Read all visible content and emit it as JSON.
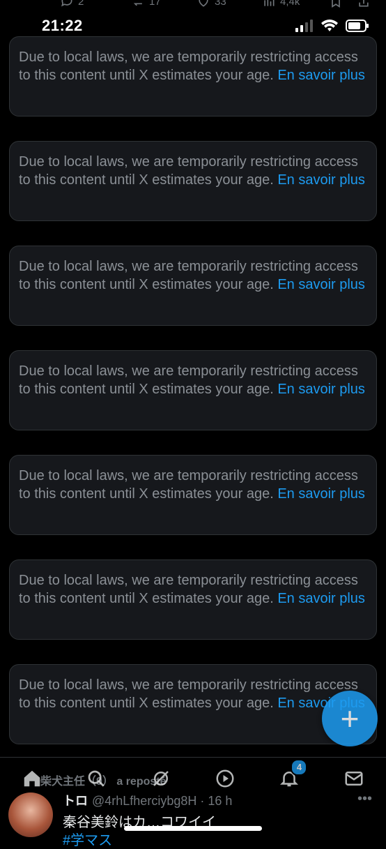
{
  "top_actions": {
    "replies": "2",
    "reposts": "17",
    "likes": "33",
    "views": "4,4k"
  },
  "status_bar": {
    "time": "21:22"
  },
  "notices": [
    {
      "text": "Due to local laws, we are temporarily restricting access to this content until X estimates your age. ",
      "link": "En savoir plus"
    },
    {
      "text": "Due to local laws, we are temporarily restricting access to this content until X estimates your age. ",
      "link": "En savoir plus"
    },
    {
      "text": "Due to local laws, we are temporarily restricting access to this content until X estimates your age. ",
      "link": "En savoir plus"
    },
    {
      "text": "Due to local laws, we are temporarily restricting access to this content until X estimates your age. ",
      "link": "En savoir plus"
    },
    {
      "text": "Due to local laws, we are temporarily restricting access to this content until X estimates your age. ",
      "link": "En savoir plus"
    },
    {
      "text": "Due to local laws, we are temporarily restricting access to this content until X estimates your age. ",
      "link": "En savoir plus"
    },
    {
      "text": "Due to local laws, we are temporarily restricting access to this content until X estimates your age. ",
      "link": "En savoir plus"
    }
  ],
  "fab": {
    "label": "+"
  },
  "next_tweet": {
    "repost_line": "柴犬主任（9） a reposté",
    "name": "トロ",
    "handle_time": "@4rhLfherciybg8H · 16 h",
    "text": "秦谷美鈴はカ…コワイイ",
    "hashtag": "#学マス"
  },
  "bottom_nav": {
    "notifications_badge": "4"
  },
  "colors": {
    "accent": "#1d9bf0",
    "card_bg": "#16181c",
    "card_border": "#2f3336",
    "muted_text": "#8b9096"
  },
  "icons": {
    "reply": "reply-icon",
    "repost": "repost-icon",
    "like": "heart-icon",
    "views": "views-icon",
    "bookmark": "bookmark-icon",
    "share": "share-icon",
    "home": "home-icon",
    "search": "search-icon",
    "grok": "grok-icon",
    "video": "play-icon",
    "notifications": "bell-icon",
    "messages": "mail-icon"
  }
}
